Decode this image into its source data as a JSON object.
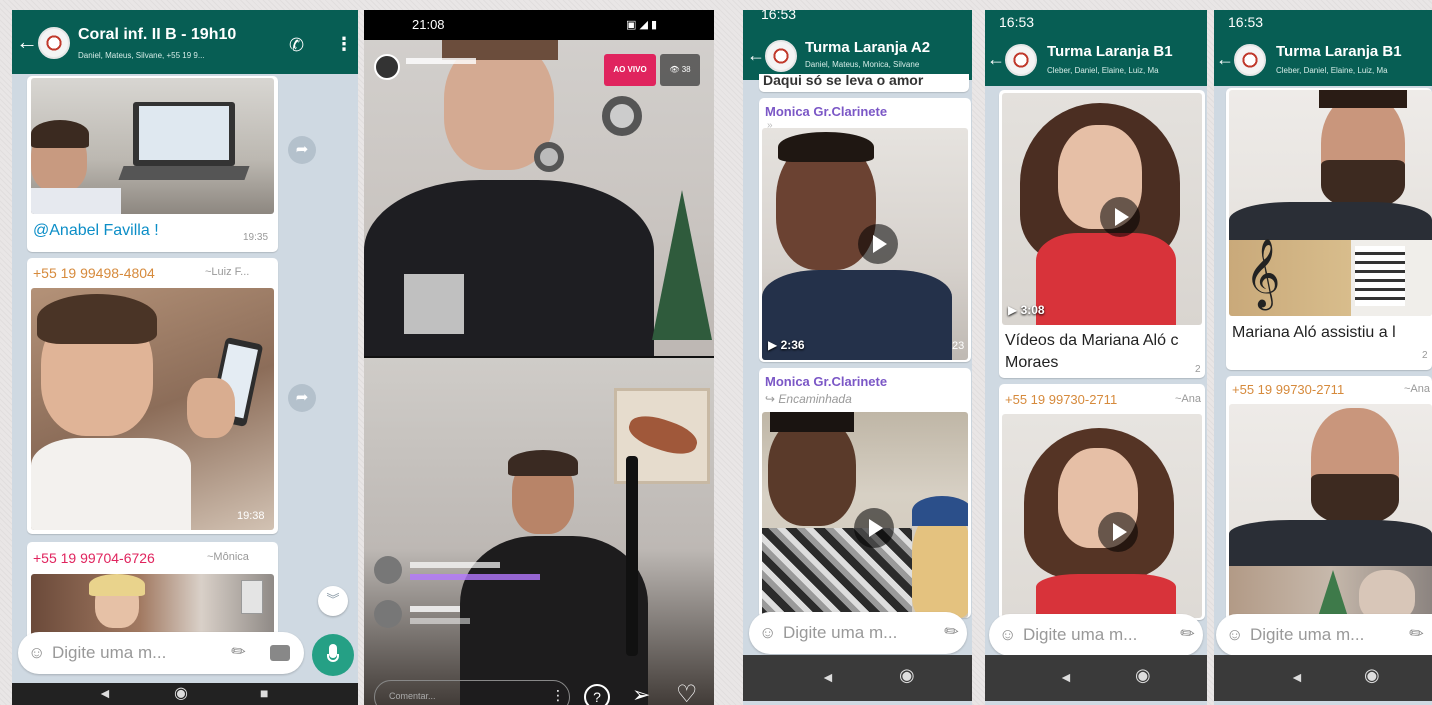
{
  "input_placeholder": "Digite uma m...",
  "p1": {
    "title": "Coral inf. II B - 19h10",
    "subtitle": "Daniel, Mateus, Silvane, +55 19 9...",
    "caption": "@Anabel Favilla !",
    "caption_time": "19:35",
    "contact1": "+55 19 99498-4804",
    "contact1_name": "~Luiz F...",
    "photo_time": "19:38",
    "contact2": "+55 19 99704-6726",
    "contact2_name": "~Mônica"
  },
  "p2": {
    "time": "21:08",
    "live": "AO VIVO",
    "viewers": "38",
    "comment_placeholder": "Comentar..."
  },
  "p3": {
    "time": "16:53",
    "title": "Turma Laranja A2",
    "subtitle": "Daniel, Mateus, Monica, Silvane",
    "top_text": "Daqui só se leva o amor",
    "sender1": "Monica Gr.Clarinete",
    "duration1": "2:36",
    "time1": "23",
    "sender2": "Monica Gr.Clarinete",
    "forwarded": "Encaminhada"
  },
  "p4": {
    "time": "16:53",
    "title": "Turma Laranja B1",
    "subtitle": "Cleber, Daniel, Elaine, Luiz, Ma",
    "duration": "3:08",
    "caption": "Vídeos da Mariana Aló c",
    "caption2": "Moraes",
    "caption_time": "2",
    "contact": "+55 19 99730-2711",
    "contact_name": "~Ana"
  },
  "p5": {
    "time": "16:53",
    "title": "Turma Laranja B1",
    "subtitle": "Cleber, Daniel, Elaine, Luiz, Ma",
    "caption": "Mariana  Aló assistiu a l",
    "caption_time": "2",
    "contact": "+55 19 99730-2711",
    "contact_name": "~Ana"
  },
  "colors": {
    "wa_header": "#075e54",
    "wa_green": "#25a085",
    "chat_bg": "#cfd9e2",
    "live_red": "#e0245e",
    "sender_purple": "#7b57c6",
    "contact_orange": "#d68a3c"
  }
}
